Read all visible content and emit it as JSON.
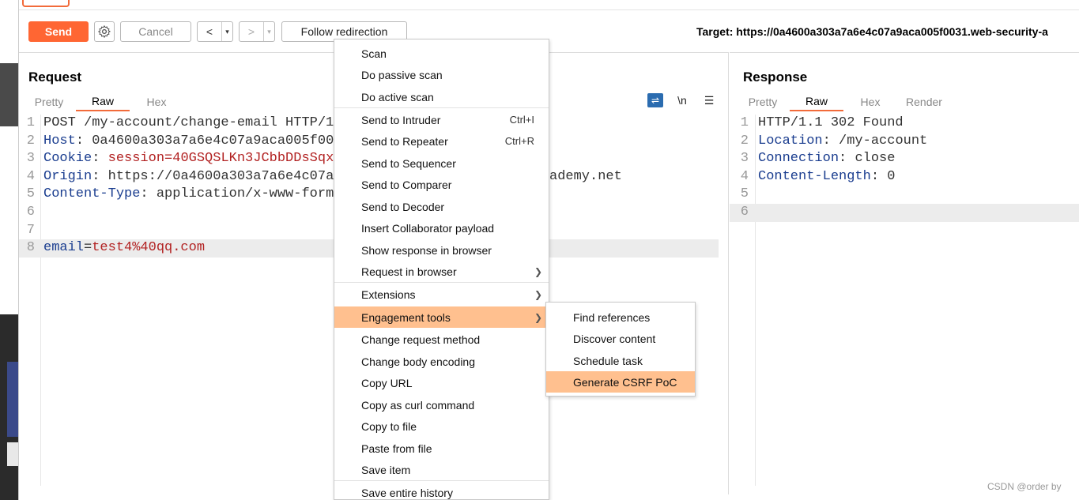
{
  "toolbar": {
    "send": "Send",
    "cancel": "Cancel",
    "back": "<",
    "forward": ">",
    "dropdown": "▾",
    "follow": "Follow redirection",
    "target": "Target: https://0a4600a303a7a6e4c07a9aca005f0031.web-security-a"
  },
  "request": {
    "title": "Request",
    "tabs": [
      "Pretty",
      "Raw",
      "Hex"
    ],
    "active_tab": "Raw",
    "tools": {
      "newline": "\\n",
      "menu": "☰"
    },
    "lines": [
      {
        "n": "1",
        "key": "",
        "sep": "",
        "val": "POST /my-account/change-email HTTP/1."
      },
      {
        "n": "2",
        "key": "Host",
        "sep": ": ",
        "val": "0a4600a303a7a6e4c07a9aca005f003"
      },
      {
        "n": "3",
        "key": "Cookie",
        "sep": ": ",
        "val": "session=40GSQSLKn3JCbbDDsSqxk"
      },
      {
        "n": "4",
        "key": "Origin",
        "sep": ": ",
        "val": "https://0a4600a303a7a6e4c07a9",
        "tail": "ademy.net"
      },
      {
        "n": "5",
        "key": "Content-Type",
        "sep": ": ",
        "val": "application/x-www-form-"
      },
      {
        "n": "6",
        "key": "",
        "sep": "",
        "val": ""
      },
      {
        "n": "7",
        "key": "",
        "sep": "",
        "val": ""
      },
      {
        "n": "8",
        "key": "email",
        "sep": "=",
        "val": "test4%40qq.com"
      }
    ]
  },
  "response": {
    "title": "Response",
    "tabs": [
      "Pretty",
      "Raw",
      "Hex",
      "Render"
    ],
    "active_tab": "Raw",
    "lines": [
      {
        "n": "1",
        "key": "",
        "sep": "",
        "val": "HTTP/1.1 302 Found"
      },
      {
        "n": "2",
        "key": "Location",
        "sep": ": ",
        "val": "/my-account"
      },
      {
        "n": "3",
        "key": "Connection",
        "sep": ": ",
        "val": "close"
      },
      {
        "n": "4",
        "key": "Content-Length",
        "sep": ": ",
        "val": "0"
      },
      {
        "n": "5",
        "key": "",
        "sep": "",
        "val": ""
      },
      {
        "n": "6",
        "key": "",
        "sep": "",
        "val": ""
      }
    ]
  },
  "context_menu": {
    "items": [
      {
        "label": "Scan"
      },
      {
        "label": "Do passive scan"
      },
      {
        "label": "Do active scan"
      },
      {
        "label": "Send to Intruder",
        "shortcut": "Ctrl+I"
      },
      {
        "label": "Send to Repeater",
        "shortcut": "Ctrl+R"
      },
      {
        "label": "Send to Sequencer"
      },
      {
        "label": "Send to Comparer"
      },
      {
        "label": "Send to Decoder"
      },
      {
        "label": "Insert Collaborator payload"
      },
      {
        "label": "Show response in browser"
      },
      {
        "label": "Request in browser",
        "submenu": true
      },
      {
        "label": "Extensions",
        "submenu": true
      },
      {
        "label": "Engagement tools",
        "submenu": true,
        "selected": true
      },
      {
        "label": "Change request method"
      },
      {
        "label": "Change body encoding"
      },
      {
        "label": "Copy URL"
      },
      {
        "label": "Copy as curl command"
      },
      {
        "label": "Copy to file"
      },
      {
        "label": "Paste from file"
      },
      {
        "label": "Save item"
      },
      {
        "label": "Save entire history"
      }
    ]
  },
  "submenu": {
    "items": [
      {
        "label": "Find references"
      },
      {
        "label": "Discover content"
      },
      {
        "label": "Schedule task"
      },
      {
        "label": "Generate CSRF PoC",
        "selected": true
      }
    ]
  },
  "watermark": "CSDN @order by",
  "colors": {
    "accent": "#ff6633",
    "menu_selected": "#ffc08f",
    "header_key": "#1a3d8f",
    "header_value": "#b22222"
  }
}
